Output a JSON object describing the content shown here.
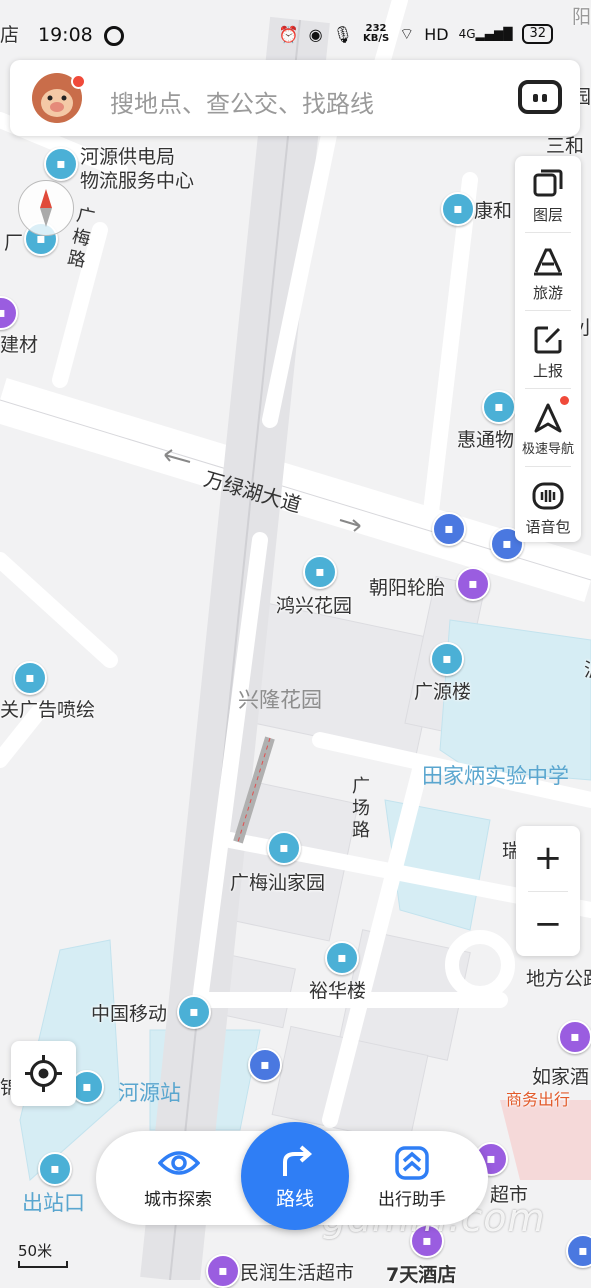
{
  "status_bar": {
    "time": "19:08",
    "net_speed": "232",
    "net_unit": "KB/S",
    "hd": "HD",
    "signal": "4G",
    "battery": "32"
  },
  "search": {
    "placeholder": "搜地点、查公交、找路线"
  },
  "tools": [
    {
      "label": "图层",
      "icon": "layers-icon"
    },
    {
      "label": "旅游",
      "icon": "travel-icon"
    },
    {
      "label": "上报",
      "icon": "report-icon"
    },
    {
      "label": "极速导航",
      "icon": "navigation-icon"
    },
    {
      "label": "语音包",
      "icon": "voice-pack-icon"
    }
  ],
  "zoom": {
    "in": "+",
    "out": "−"
  },
  "bottom": {
    "explore": "城市探索",
    "route": "路线",
    "assistant": "出行助手"
  },
  "scale": "50米",
  "watermark": "gdmm.com",
  "map_labels": {
    "heyuan_power_1": "河源供电局",
    "heyuan_power_2": "物流服务中心",
    "kanghe": "康和",
    "sanhe": "三和",
    "guangmei_road": "广梅路",
    "chang": "厂",
    "jiancai": "建材",
    "xiao": "小",
    "huitong": "惠通物",
    "wanlvhu": "万绿湖大道",
    "hongxing": "鸿兴花园",
    "chaoyang": "朝阳轮胎",
    "guangao": "关广告喷绘",
    "xinglong": "兴隆花园",
    "guangyuan": "广源楼",
    "tianjiabing": "田家炳实验中学",
    "guangchang_road": "广场路",
    "guangmeishan": "广梅汕家园",
    "yuhua": "裕华楼",
    "difanggong": "地方公路",
    "zhongguoyidong": "中国移动",
    "heyuan_station": "河源站",
    "rujia": "如家酒",
    "shangwu": "商务出行",
    "chaoshi": "超市",
    "chuzhankou": "出站口",
    "minrun": "民润生活超市",
    "qitian": "7天酒店",
    "zi": "店",
    "yang": "阳",
    "yuan": "园",
    "he": "河",
    "jiang": "泸",
    "rui": "瑞",
    "zhen": "锦"
  }
}
